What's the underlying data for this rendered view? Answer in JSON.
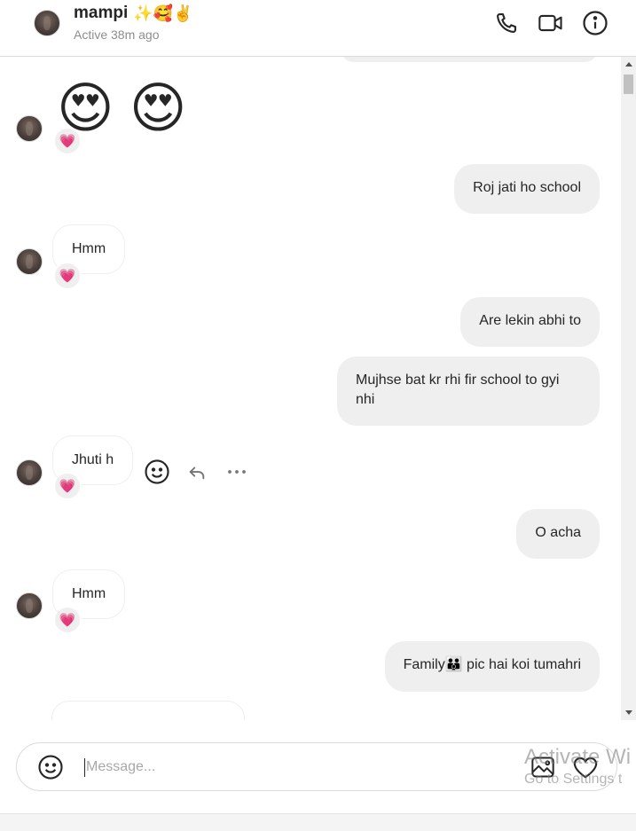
{
  "header": {
    "name": "mampi",
    "name_emoji": "✨🥰✌️",
    "status": "Active 38m ago",
    "icons": [
      "phone-icon",
      "video-icon",
      "info-icon"
    ]
  },
  "messages": {
    "emoji_msg": "😍 😍",
    "reaction": "💗",
    "out1": "Roj jati ho school",
    "in1": "Hmm",
    "out2": "Are lekin abhi to",
    "out3": "Mujhse bat kr rhi fir school to gyi nhi",
    "in2": "Jhuti h",
    "out4": "O acha",
    "in3": "Hmm",
    "out5_before": "Family",
    "out5_emoji": "👪",
    "out5_after": " pic hai koi tumahri"
  },
  "composer": {
    "placeholder": "Message..."
  },
  "watermark": {
    "title": "Activate Wi",
    "subtitle": "Go to Settings t"
  },
  "colors": {
    "outgoing_bubble": "#efefef",
    "reaction_heart": "#ff3b6b"
  }
}
